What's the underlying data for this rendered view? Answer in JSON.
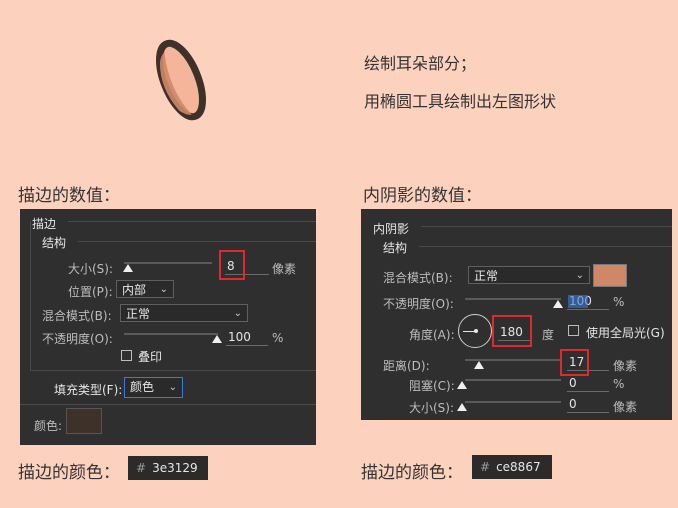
{
  "intro": {
    "line1": "绘制耳朵部分；",
    "line2": "用椭圆工具绘制出左图形状"
  },
  "left": {
    "caption": "描边的数值：",
    "panel": {
      "title": "描边",
      "section": "结构",
      "size_label": "大小(S):",
      "size_value": "8",
      "size_unit": "像素",
      "size_level_fraction": 0.05,
      "position_label": "位置(P):",
      "position_value": "内部",
      "blend_label": "混合模式(B):",
      "blend_value": "正常",
      "opacity_label": "不透明度(O):",
      "opacity_value": "100",
      "opacity_unit": "%",
      "overprint_label": "叠印",
      "fill_type_label": "填充类型(F):",
      "fill_type_value": "颜色",
      "color_label": "颜色:",
      "color_swatch": "#3e3129"
    },
    "color_caption": "描边的颜色：",
    "hex": "3e3129"
  },
  "right": {
    "caption": "内阴影的数值：",
    "panel": {
      "title": "内阴影",
      "section": "结构",
      "blend_label": "混合模式(B):",
      "blend_value": "正常",
      "blend_swatch": "#ce8867",
      "opacity_label": "不透明度(O):",
      "opacity_value": "100",
      "opacity_unit": "%",
      "angle_label": "角度(A):",
      "angle_value": "180",
      "angle_unit": "度",
      "global_light_label": "使用全局光(G)",
      "distance_label": "距离(D):",
      "distance_value": "17",
      "distance_unit": "像素",
      "choke_label": "阻塞(C):",
      "choke_value": "0",
      "choke_unit": "%",
      "size_label": "大小(S):",
      "size_value": "0",
      "size_unit": "像素"
    },
    "color_caption": "描边的颜色：",
    "hex": "ce8867"
  },
  "colors": {
    "background": "#fcd2bf",
    "ear_outline": "#3e3129",
    "ear_fill": "#f5b59a",
    "ear_shadow": "#ce8867",
    "highlight": "#e02a2a"
  }
}
